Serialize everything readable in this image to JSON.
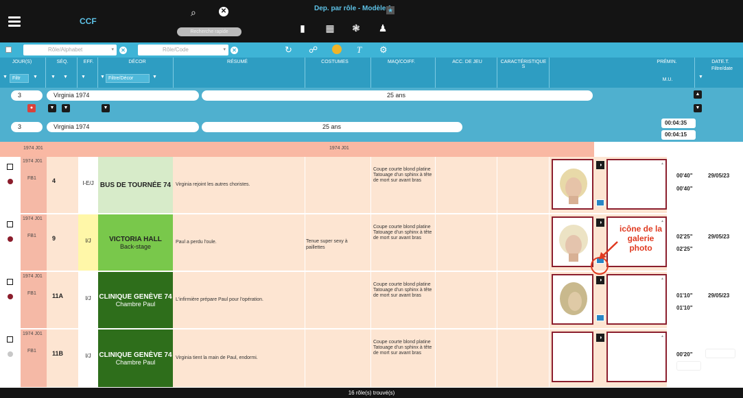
{
  "app": {
    "title": "CCF",
    "model_title": "Dep. par rôle - Modèle 1",
    "quick_search_placeholder": "Recherche rapide"
  },
  "filters": {
    "role_alpha_placeholder": "Rôle/Alphabet",
    "role_code_placeholder": "Rôle/Code"
  },
  "columns": {
    "jours": "JOUR(S)",
    "seq": "SÉQ.",
    "eff": "EFF.",
    "decor": "DÉCOR",
    "resume": "RÉSUMÉ",
    "costumes": "COSTUMES",
    "maq": "MAQ/COIFF.",
    "acc": "ACC. DE JEU",
    "carac": "CARACTÉRISTIQUE S",
    "premin": "PRÉMIN.",
    "mu": "M.U.",
    "datet": "DATE.T.",
    "filtre_date": "Filtre/date",
    "filtr": "Filtr",
    "filtre_decor": "Filtre/Décor"
  },
  "group": {
    "number": "3",
    "name": "Virginia 1974",
    "age": "25 ans",
    "time1": "00:04:35",
    "time2": "00:04:15"
  },
  "jour_band": {
    "left": "1974 J01",
    "center": "1974 J01"
  },
  "rows": [
    {
      "jour": "1974 J01",
      "code": "FB1",
      "seq": "4",
      "eff": "I-E/J",
      "decor1": "BUS DE TOURNÉE 74",
      "decor2": "",
      "resume": "Virginia rejoint les autres choristes.",
      "costume": "",
      "maq": "Coupe courte blond platine Tatouage d'un sphinx à tête de mort sur avant bras",
      "t1": "00'40\"",
      "t2": "00'40\"",
      "date": "29/05/23"
    },
    {
      "jour": "1974 J01",
      "code": "FB1",
      "seq": "9",
      "eff": "I/J",
      "decor1": "VICTORIA HALL",
      "decor2": "Back-stage",
      "resume": "Paul a perdu l'oule.",
      "costume": "Tenue super sexy à paillettes",
      "maq": "Coupe courte blond platine Tatouage d'un sphinx à tête de mort sur avant bras",
      "t1": "02'25\"",
      "t2": "02'25\"",
      "date": "29/05/23"
    },
    {
      "jour": "1974 J01",
      "code": "FB1",
      "seq": "11A",
      "eff": "I/J",
      "decor1": "CLINIQUE GENÈVE 74",
      "decor2": "Chambre Paul",
      "resume": "L'infirmière prépare Paul pour l'opération.",
      "costume": "",
      "maq": "Coupe courte blond platine Tatouage d'un sphinx à tête de mort sur avant bras",
      "t1": "01'10\"",
      "t2": "01'10\"",
      "date": "29/05/23"
    },
    {
      "jour": "1974 J01",
      "code": "FB1",
      "seq": "11B",
      "eff": "I/J",
      "decor1": "CLINIQUE GENÈVE 74",
      "decor2": "Chambre Paul",
      "resume": "Virginia tient la main de Paul, endormi.",
      "costume": "",
      "maq": "Coupe courte blond platine Tatouage d'un sphinx à tête de mort sur avant bras",
      "t1": "00'20\"",
      "t2": "",
      "date": ""
    }
  ],
  "annotation": "icône de la galerie photo",
  "footer": "16 rôle(s) trouvé(s)",
  "colors": {
    "accent": "#3eb4d6",
    "row_bg": "#fde5d2",
    "annotation": "#e03a20",
    "photo_border": "#8b1d2c"
  }
}
